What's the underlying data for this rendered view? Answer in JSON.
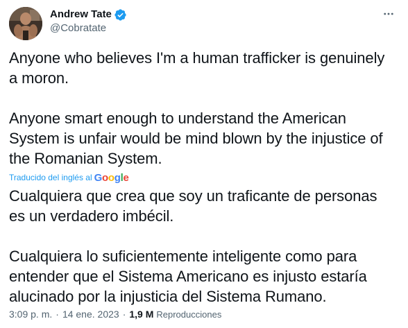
{
  "author": {
    "name": "Andrew Tate",
    "handle": "@Cobratate",
    "verified": true
  },
  "tweet": {
    "original_text": "Anyone who believes I'm a human trafficker is genuinely a moron.\n\nAnyone smart enough to understand the American System is unfair would be mind blown by the injustice of the Romanian System.",
    "translation_label": "Traducido del inglés al",
    "translation_provider": "Google",
    "translated_text": "Cualquiera que crea que soy un traficante de personas es un verdadero imbécil.\n\nCualquiera lo suficientemente inteligente como para entender que el Sistema Americano es injusto estaría alucinado por la injusticia del Sistema Rumano."
  },
  "meta": {
    "time": "3:09 p. m.",
    "separator": "·",
    "date": "14 ene. 2023",
    "views_count": "1,9 M",
    "views_label": "Reproducciones"
  },
  "colors": {
    "text": "#0f1419",
    "secondary": "#536471",
    "accent": "#1d9bf0"
  },
  "icons": {
    "verified": "verified-badge-icon",
    "more": "more-options-icon"
  }
}
